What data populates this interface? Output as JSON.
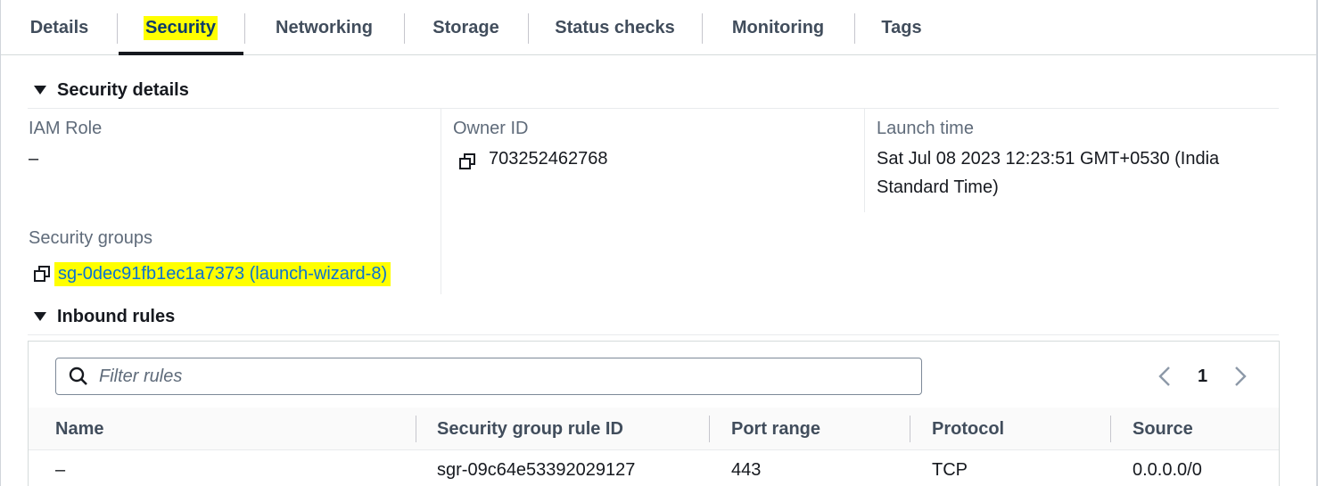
{
  "tabs": [
    {
      "label": "Details"
    },
    {
      "label": "Security"
    },
    {
      "label": "Networking"
    },
    {
      "label": "Storage"
    },
    {
      "label": "Status checks"
    },
    {
      "label": "Monitoring"
    },
    {
      "label": "Tags"
    }
  ],
  "security_details": {
    "heading": "Security details",
    "iam_role_label": "IAM Role",
    "iam_role_value": "–",
    "owner_id_label": "Owner ID",
    "owner_id_value": "703252462768",
    "launch_time_label": "Launch time",
    "launch_time_line1": "Sat Jul 08 2023 12:23:51 GMT+0530 (India",
    "launch_time_line2": "Standard Time)",
    "security_groups_label": "Security groups",
    "security_group_link": "sg-0dec91fb1ec1a7373 (launch-wizard-8)"
  },
  "inbound_rules": {
    "heading": "Inbound rules",
    "filter_placeholder": "Filter rules",
    "page_number": "1",
    "columns": [
      "Name",
      "Security group rule ID",
      "Port range",
      "Protocol",
      "Source"
    ],
    "rows": [
      [
        "–",
        "sgr-09c64e53392029127",
        "443",
        "TCP",
        "0.0.0.0/0"
      ]
    ]
  },
  "colors": {
    "highlight": "#ffff00",
    "link": "#0972d3",
    "text": "#16191f",
    "muted": "#5f6b7a"
  },
  "icons": {
    "copy": "copy-icon",
    "search": "search-icon",
    "collapse": "caret-down-icon",
    "prev": "chevron-left-icon",
    "next": "chevron-right-icon"
  }
}
